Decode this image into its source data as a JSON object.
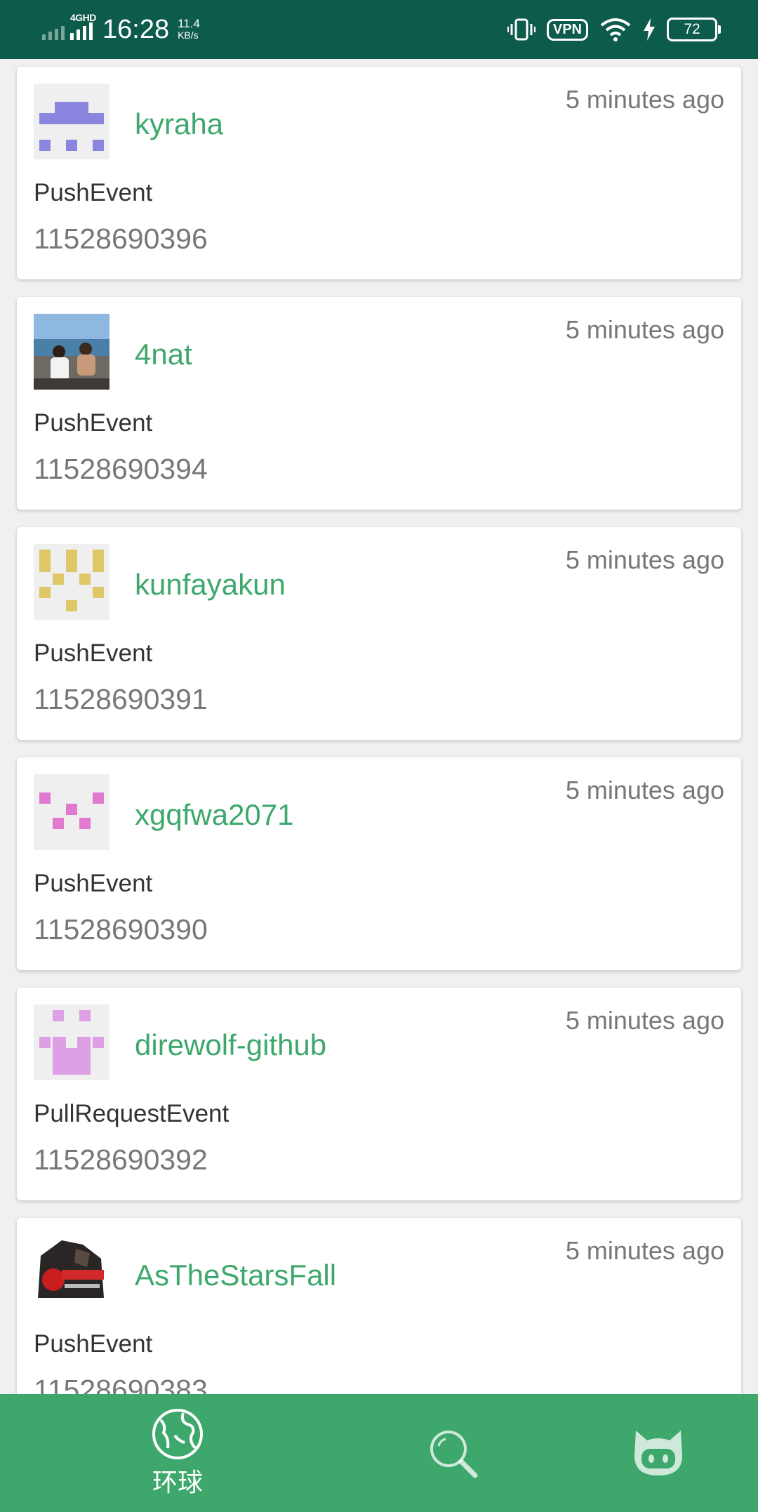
{
  "status_bar": {
    "network": "4GHD",
    "time": "16:28",
    "speed_value": "11.4",
    "speed_unit": "KB/s",
    "vpn": "VPN",
    "battery": "72"
  },
  "events": [
    {
      "username": "kyraha",
      "time_ago": "5 minutes ago",
      "event_type": "PushEvent",
      "event_id": "11528690396",
      "avatar": "identicon-purple"
    },
    {
      "username": "4nat",
      "time_ago": "5 minutes ago",
      "event_type": "PushEvent",
      "event_id": "11528690394",
      "avatar": "photo-beach"
    },
    {
      "username": "kunfayakun",
      "time_ago": "5 minutes ago",
      "event_type": "PushEvent",
      "event_id": "11528690391",
      "avatar": "identicon-yellow"
    },
    {
      "username": "xgqfwa2071",
      "time_ago": "5 minutes ago",
      "event_type": "PushEvent",
      "event_id": "11528690390",
      "avatar": "identicon-pink"
    },
    {
      "username": "direwolf-github",
      "time_ago": "5 minutes ago",
      "event_type": "PullRequestEvent",
      "event_id": "11528690392",
      "avatar": "identicon-lilac"
    },
    {
      "username": "AsTheStarsFall",
      "time_ago": "5 minutes ago",
      "event_type": "PushEvent",
      "event_id": "11528690383",
      "avatar": "photo-anime"
    }
  ],
  "bottom_nav": {
    "items": [
      {
        "label": "环球",
        "icon": "globe-icon",
        "active": true
      },
      {
        "label": "",
        "icon": "search-icon",
        "active": false
      },
      {
        "label": "",
        "icon": "octocat-icon",
        "active": false
      }
    ]
  },
  "colors": {
    "status_bar": "#0d5b4a",
    "accent": "#3ea86c",
    "background": "#f0f0f0",
    "card": "#ffffff",
    "secondary_text": "#777777"
  }
}
